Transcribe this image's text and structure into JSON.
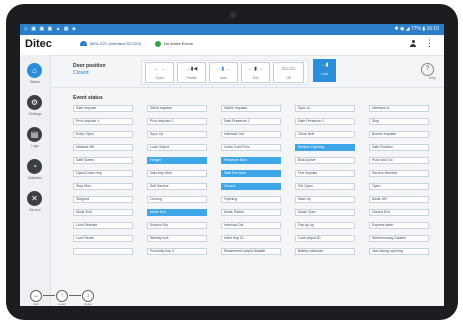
{
  "status_bar": {
    "left": "◇ ▣ ▣ ▣ ▲ ▦ ◈",
    "center": "▫",
    "right": "✱ ◉ ◢ 77% ▮ 16:15"
  },
  "app": {
    "logo": "Ditec",
    "connection": "MKA-C21 (Interface:DC2D3)",
    "alarm_text": "No Active Errors"
  },
  "icons": {
    "user": "user-icon",
    "more": "more-vertical-icon",
    "info": "info-icon",
    "wifi": "wifi-icon"
  },
  "sidebar": {
    "items": [
      {
        "label": "Status",
        "icon": "home-icon"
      },
      {
        "label": "Settings",
        "icon": "gear-icon"
      },
      {
        "label": "Logs",
        "icon": "document-icon"
      },
      {
        "label": "Statistics",
        "icon": "chart-icon"
      },
      {
        "label": "Service",
        "icon": "wrench-icon"
      }
    ]
  },
  "door": {
    "title": "Door position",
    "value": "Closed"
  },
  "modes": [
    {
      "glyph": "← →",
      "label": "Open"
    },
    {
      "glyph": "→▮◀",
      "label": "Partial"
    },
    {
      "glyph": "→▮ ←",
      "label": "Auto"
    },
    {
      "glyph": "← ▮ →",
      "label": "Exit"
    },
    {
      "glyph": "▭▭▭",
      "label": "Off"
    }
  ],
  "lock": {
    "glyph": "→▮",
    "label": "Lock"
  },
  "info": {
    "label": "Help"
  },
  "section": {
    "title": "Event status"
  },
  "events": [
    [
      "Safe Impulse",
      "Silent Impulse",
      "Stable Impulse",
      "Sync to...",
      "Interface to"
    ],
    [
      "Prox Impulse 1",
      "Prox Impulse 2",
      "Safe Presence 1",
      "Safe Presence 2",
      "Stop"
    ],
    [
      "Entry Open",
      "Sync Op",
      "Interlock Out",
      "Close limit",
      "Buzzer Impulse"
    ],
    [
      "Infrared HB",
      "Lock Output",
      "Learn Conf Proc",
      "Reduce Opening",
      "Safe Position"
    ],
    [
      "Safe Speed",
      "Freight",
      "Presence Mon",
      "Brak Active",
      "Push And Go"
    ],
    [
      "Open/Close Hop",
      "Inter-Imp Mon",
      "Safe Pos Mon",
      "Fire Impulse",
      "Service Needed"
    ],
    [
      "Stop Mon",
      "Self Service",
      "Closed",
      "Pet Open",
      "Open"
    ],
    [
      "Stopped",
      "Closing",
      "Opening",
      "Start Up",
      "Mode DIP"
    ],
    [
      "Mode Exit",
      "Mode Exit",
      "Mode Partial",
      "Mode Open",
      "Closed Exit"
    ],
    [
      "Lock Release",
      "Sustain Dip",
      "Interlock Dis",
      "Pay Ap up",
      "Express timer"
    ],
    [
      "Lock Reset",
      "Weekly lock",
      "Interl Hop ID",
      "Lock output ID",
      "Weekmonday Disable"
    ],
    [
      "",
      "Proximity hop 3",
      "Retainment output Disable",
      "Battery takeover",
      "Jam during opening"
    ]
  ],
  "highlighted": [
    {
      "row": 3,
      "col": 3
    },
    {
      "row": 4,
      "col": 1
    },
    {
      "row": 4,
      "col": 2
    },
    {
      "row": 5,
      "col": 2
    },
    {
      "row": 6,
      "col": 2
    },
    {
      "row": 8,
      "col": 1
    }
  ],
  "manual": [
    {
      "glyph": "↔",
      "label": "Exit"
    },
    {
      "glyph": "↑",
      "label": "Lower"
    },
    {
      "glyph": "↓",
      "label": "Upper"
    }
  ],
  "colors": {
    "accent": "#2b8ed8",
    "highlight": "#3fa7e8",
    "status_bar": "#2b7fc9",
    "ok": "#2ea84a"
  }
}
